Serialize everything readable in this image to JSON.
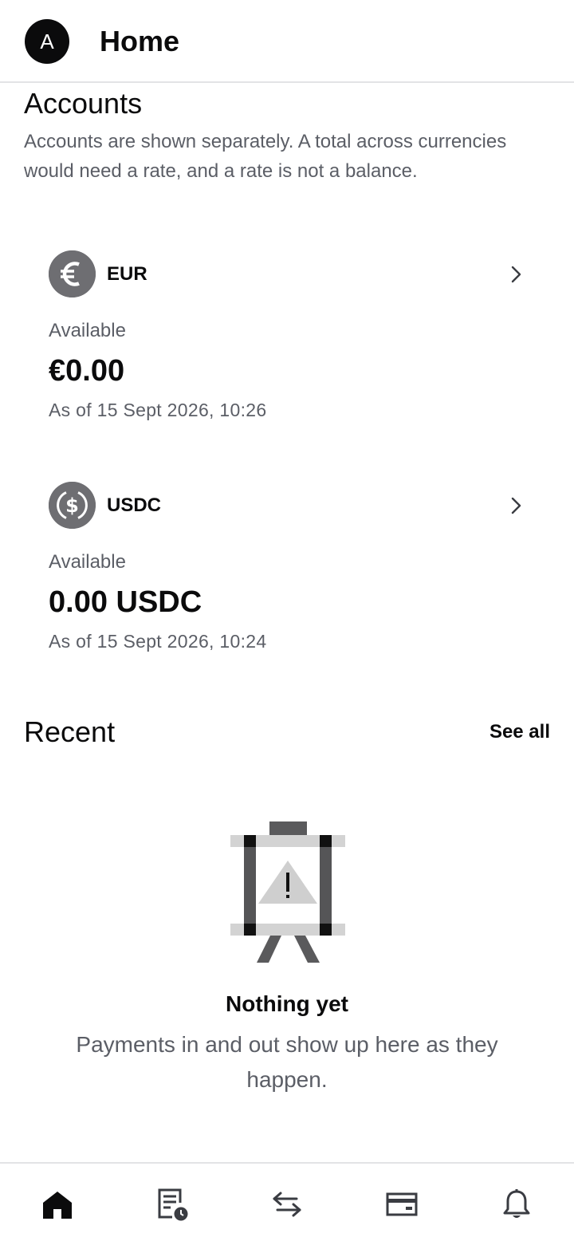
{
  "header": {
    "avatar_initial": "A",
    "title": "Home"
  },
  "accounts": {
    "title": "Accounts",
    "description": "Accounts are shown separately. A total across currencies would need a rate, and a rate is not a balance.",
    "items": [
      {
        "currency": "EUR",
        "icon": "euro-coin-icon",
        "available_label": "Available",
        "balance": "€0.00",
        "as_of": "As of 15 Sept 2026, 10:26"
      },
      {
        "currency": "USDC",
        "icon": "usdc-coin-icon",
        "available_label": "Available",
        "balance": "0.00 USDC",
        "as_of": "As of 15 Sept 2026, 10:24"
      }
    ]
  },
  "recent": {
    "title": "Recent",
    "see_all_label": "See all",
    "empty_icon": "empty-easel-warning-icon",
    "empty_title": "Nothing yet",
    "empty_description": "Payments in and out show up here as they happen."
  },
  "bottom_nav": {
    "items": [
      {
        "name": "home",
        "icon": "home-icon",
        "active": true
      },
      {
        "name": "activity",
        "icon": "statement-clock-icon",
        "active": false
      },
      {
        "name": "transfer",
        "icon": "transfer-arrows-icon",
        "active": false
      },
      {
        "name": "cards",
        "icon": "card-icon",
        "active": false
      },
      {
        "name": "notifications",
        "icon": "bell-icon",
        "active": false
      }
    ]
  },
  "colors": {
    "text_primary": "#0b0b0c",
    "text_secondary": "#5b5e66",
    "coin_gray": "#6e6e72",
    "divider": "#e2e3e6"
  }
}
